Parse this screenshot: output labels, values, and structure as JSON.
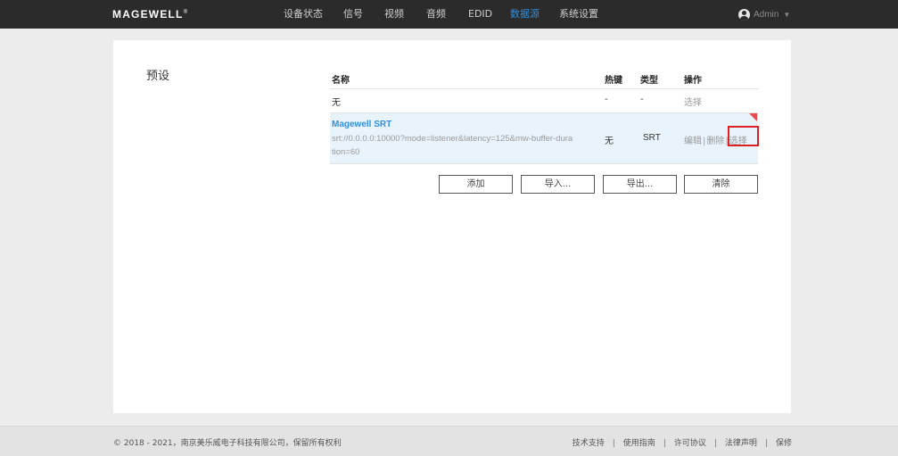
{
  "header": {
    "logo": "MAGEWELL",
    "logo_mark": "®",
    "nav": [
      "设备状态",
      "信号",
      "视频",
      "音频",
      "EDID",
      "数据源",
      "系统设置"
    ],
    "active_nav": "数据源",
    "user": "Admin",
    "colors": {
      "bar": "#2b2b2b",
      "accent": "#2f8fe0"
    }
  },
  "page": {
    "section_title": "预设",
    "columns": {
      "name": "名称",
      "hotkey": "热键",
      "type": "类型",
      "ops": "操作"
    },
    "rows": [
      {
        "name": "无",
        "hotkey": "-",
        "type": "-",
        "action": "选择"
      },
      {
        "name": "Magewell SRT",
        "url": "srt://0.0.0.0:10000?mode=listener&latency=125&mw-buffer-duration=60",
        "hotkey": "无",
        "type": "SRT",
        "actions": {
          "edit": "编辑",
          "delete": "删除",
          "select": "选择",
          "separator": "|"
        }
      }
    ],
    "buttons": {
      "add": "添加",
      "import": "导入...",
      "export": "导出...",
      "clear": "清除"
    }
  },
  "footer": {
    "copyright": "© 2018 - 2021，南京美乐威电子科技有限公司，保留所有权利",
    "links": [
      "技术支持",
      "使用指南",
      "许可协议",
      "法律声明",
      "保修"
    ],
    "link_separator": "|"
  }
}
